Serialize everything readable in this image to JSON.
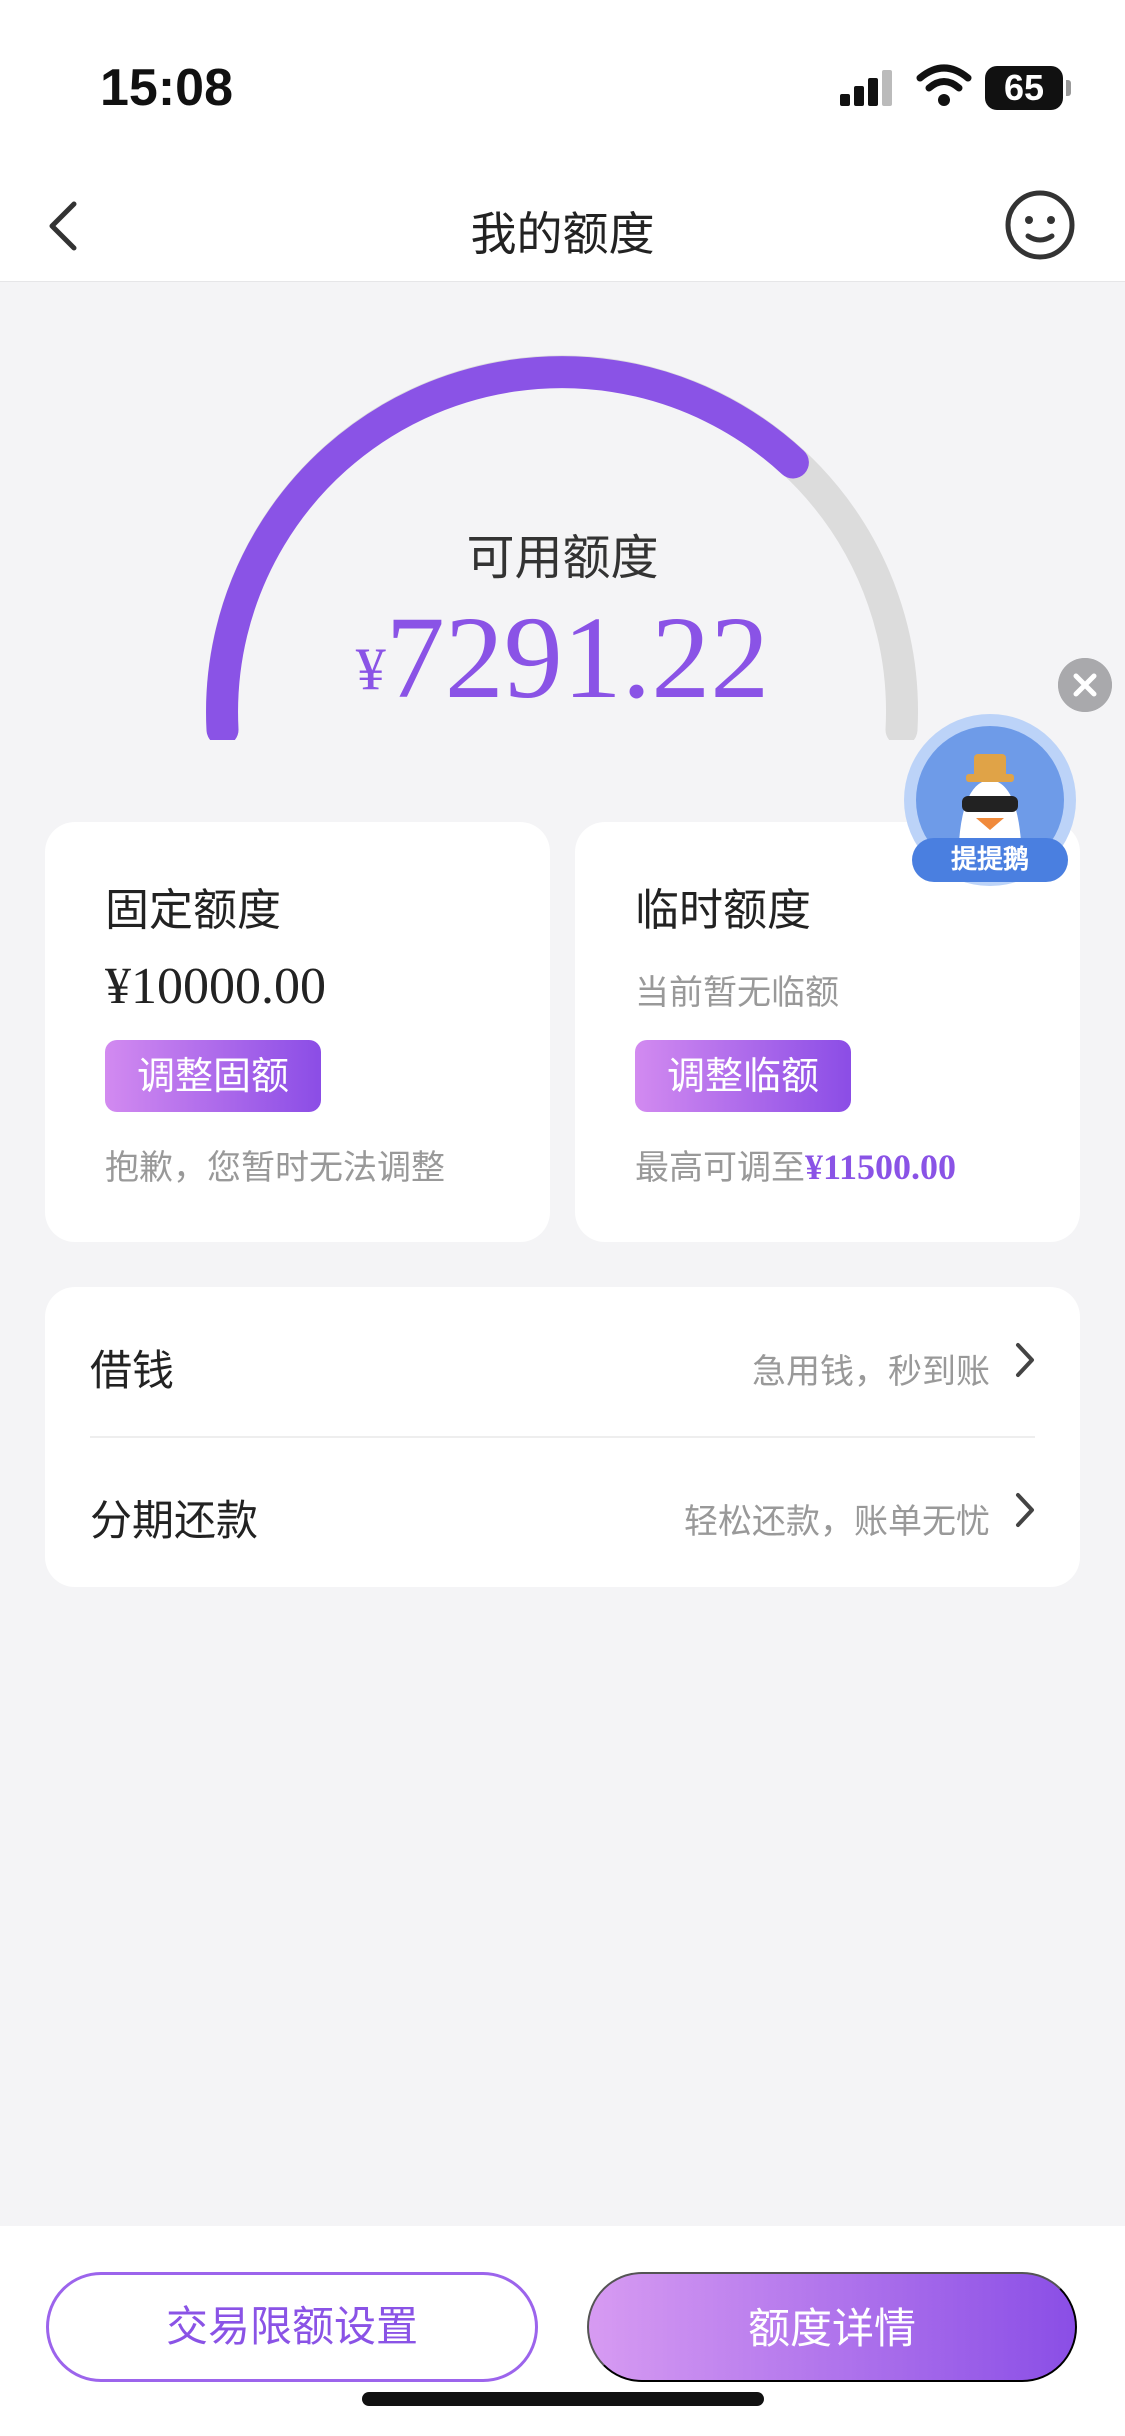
{
  "status_bar": {
    "time": "15:08",
    "battery": "65"
  },
  "nav": {
    "title": "我的额度"
  },
  "gauge": {
    "label": "可用额度",
    "currency": "¥",
    "amount": "7291.22",
    "used_fraction": 0.73,
    "accent_color": "#8a53e6",
    "track_color": "#dcdcdc"
  },
  "fixed_card": {
    "title": "固定额度",
    "amount": "¥10000.00",
    "button": "调整固额",
    "note": "抱歉，您暂时无法调整"
  },
  "temp_card": {
    "title": "临时额度",
    "subtitle": "当前暂无临额",
    "button": "调整临额",
    "note_prefix": "最高可调至",
    "note_amount": "¥11500.00"
  },
  "floating": {
    "mascot_label": "提提鹅"
  },
  "menu": [
    {
      "label": "借钱",
      "hint": "急用钱，秒到账"
    },
    {
      "label": "分期还款",
      "hint": "轻松还款，账单无忧"
    }
  ],
  "bottom": {
    "limit_button": "交易限额设置",
    "detail_button": "额度详情"
  },
  "icons": [
    "back-icon",
    "customer-service-icon",
    "chevron-right-icon",
    "close-icon",
    "signal-icon",
    "wifi-icon"
  ]
}
